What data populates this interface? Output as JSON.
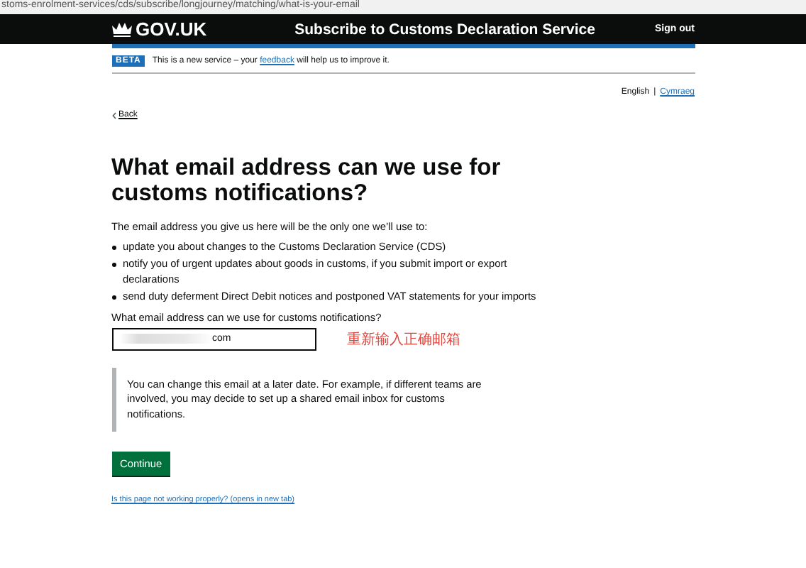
{
  "url": "stoms-enrolment-services/cds/subscribe/longjourney/matching/what-is-your-email",
  "header": {
    "logo": "GOV.UK",
    "service": "Subscribe to Customs Declaration Service",
    "sign_out": "Sign out"
  },
  "beta": {
    "tag": "BETA",
    "before": "This is a new service – your",
    "link": "feedback",
    "after": "will help us to improve it."
  },
  "language_separator": "|",
  "languages": [
    {
      "label": "English",
      "selected": true
    },
    {
      "label": "Cymraeg",
      "selected": false
    }
  ],
  "back": "Back",
  "heading": "What email address can we use for customs notifications?",
  "intro": "The email address you give us here will be the only one we’ll use to:",
  "bullets": [
    "update you about changes to the Customs Declaration Service (CDS)",
    "notify you of urgent updates about goods in customs, if you submit import or export declarations",
    "send duty deferment Direct Debit notices and postponed VAT statements for your imports"
  ],
  "field": {
    "label": "What email address can we use for customs notifications?",
    "value": "com"
  },
  "annotation": "重新输入正确邮箱",
  "inset": "You can change this email at a later date. For example, if different teams are involved, you may decide to set up a shared email inbox for customs notifications.",
  "button": "Continue",
  "help_link": "Is this page not working properly? (opens in new tab)"
}
